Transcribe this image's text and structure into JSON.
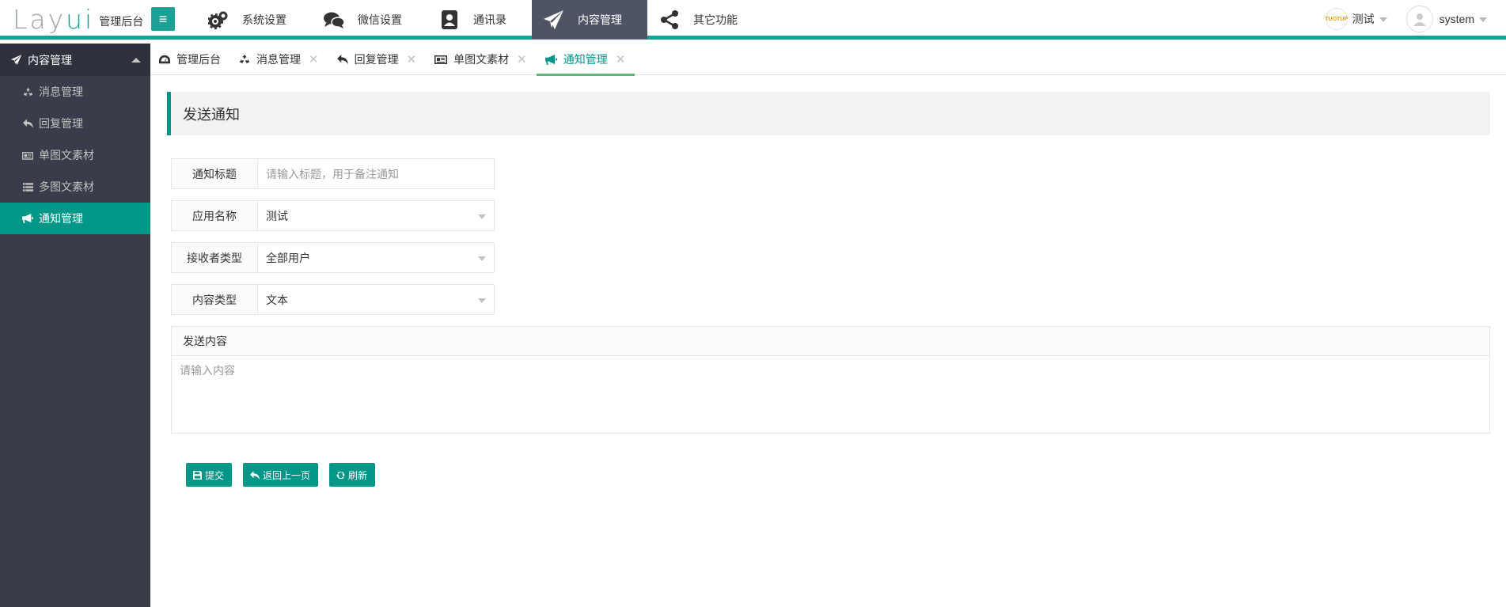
{
  "header": {
    "logo_main": "Lay",
    "logo_accent": "ui",
    "logo_sub": "管理后台",
    "nav": [
      {
        "label": "系统设置",
        "icon": "gears-icon"
      },
      {
        "label": "微信设置",
        "icon": "chat-bubbles-icon"
      },
      {
        "label": "通讯录",
        "icon": "contact-book-icon"
      },
      {
        "label": "内容管理",
        "icon": "paper-plane-icon",
        "active": true
      },
      {
        "label": "其它功能",
        "icon": "share-icon"
      }
    ],
    "app_logo_text": "TUOTUP",
    "app_name": "测试",
    "username": "system"
  },
  "sidebar": {
    "section_title": "内容管理",
    "items": [
      {
        "label": "消息管理",
        "icon": "recycle-icon"
      },
      {
        "label": "回复管理",
        "icon": "reply-icon"
      },
      {
        "label": "单图文素材",
        "icon": "newspaper-icon"
      },
      {
        "label": "多图文素材",
        "icon": "list-icon"
      },
      {
        "label": "通知管理",
        "icon": "bullhorn-icon",
        "active": true
      }
    ]
  },
  "tabs": [
    {
      "label": "管理后台",
      "icon": "dashboard-icon",
      "closable": false
    },
    {
      "label": "消息管理",
      "icon": "recycle-icon",
      "closable": true
    },
    {
      "label": "回复管理",
      "icon": "reply-icon",
      "closable": true
    },
    {
      "label": "单图文素材",
      "icon": "newspaper-icon",
      "closable": true
    },
    {
      "label": "通知管理",
      "icon": "bullhorn-icon",
      "closable": true,
      "active": true
    }
  ],
  "tab_close_symbol": "✕",
  "page": {
    "title": "发送通知",
    "form": {
      "title_label": "通知标题",
      "title_placeholder": "请输入标题，用于备注通知",
      "app_label": "应用名称",
      "app_value": "测试",
      "receiver_label": "接收者类型",
      "receiver_value": "全部用户",
      "content_type_label": "内容类型",
      "content_type_value": "文本",
      "content_label": "发送内容",
      "content_placeholder": "请输入内容"
    },
    "buttons": {
      "submit": "提交",
      "back": "返回上一页",
      "refresh": "刷新"
    }
  },
  "colors": {
    "primary": "#009688",
    "header_border": "#1aa094",
    "sidebar_bg": "#393d49",
    "nav_active_bg": "#4e5465"
  }
}
